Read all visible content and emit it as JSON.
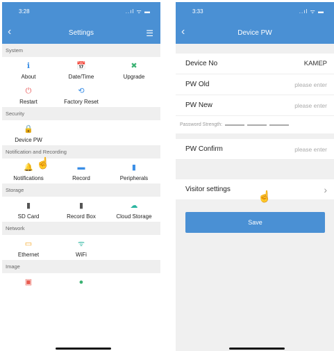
{
  "left": {
    "time": "3:28",
    "status_icons": "..ıl ᯤ ▬",
    "title": "Settings",
    "sections": [
      {
        "label": "System",
        "items": [
          {
            "label": "About",
            "icon": "info-icon",
            "glyph": "ℹ",
            "color": "#3a8ee6"
          },
          {
            "label": "Date/Time",
            "icon": "calendar-icon",
            "glyph": "📅",
            "color": "#e85a4f"
          },
          {
            "label": "Upgrade",
            "icon": "tools-icon",
            "glyph": "✖",
            "color": "#3bb273"
          },
          {
            "label": "Restart",
            "icon": "restart-icon",
            "glyph": "⏻",
            "color": "#e85a5a"
          },
          {
            "label": "Factory Reset",
            "icon": "reset-icon",
            "glyph": "⟲",
            "color": "#3a8ee6"
          }
        ]
      },
      {
        "label": "Security",
        "items": [
          {
            "label": "Device PW",
            "icon": "lock-icon",
            "glyph": "🔒",
            "color": "#3bb273"
          }
        ]
      },
      {
        "label": "Notification and Recording",
        "items": [
          {
            "label": "Notifications",
            "icon": "bell-icon",
            "glyph": "🔔",
            "color": "#f5a623"
          },
          {
            "label": "Record",
            "icon": "video-icon",
            "glyph": "▬",
            "color": "#3a8ee6"
          },
          {
            "label": "Peripherals",
            "icon": "peripheral-icon",
            "glyph": "▮",
            "color": "#3a8ee6"
          }
        ]
      },
      {
        "label": "Storage",
        "items": [
          {
            "label": "SD Card",
            "icon": "sdcard-icon",
            "glyph": "▮",
            "color": "#555"
          },
          {
            "label": "Record Box",
            "icon": "recordbox-icon",
            "glyph": "▮",
            "color": "#555"
          },
          {
            "label": "Cloud Storage",
            "icon": "cloud-icon",
            "glyph": "☁",
            "color": "#2bb5a0"
          }
        ]
      },
      {
        "label": "Network",
        "items": [
          {
            "label": "Ethernet",
            "icon": "ethernet-icon",
            "glyph": "▭",
            "color": "#f5a623"
          },
          {
            "label": "WiFi",
            "icon": "wifi-icon",
            "glyph": "ᯤ",
            "color": "#2bb5a0"
          }
        ]
      },
      {
        "label": "Image",
        "items": [
          {
            "label": "",
            "icon": "image-icon",
            "glyph": "▣",
            "color": "#e85a4f"
          },
          {
            "label": "",
            "icon": "osd-icon",
            "glyph": "●",
            "color": "#3bb273"
          }
        ]
      }
    ]
  },
  "right": {
    "time": "3:33",
    "status_icons": "..ıl ᯤ ▬",
    "title": "Device PW",
    "device_no_label": "Device No",
    "device_no_value": "KAMEP",
    "pw_old_label": "PW Old",
    "pw_old_placeholder": "please enter",
    "pw_new_label": "PW New",
    "pw_new_placeholder": "please enter",
    "strength_label": "Password Strength:",
    "pw_confirm_label": "PW Confirm",
    "pw_confirm_placeholder": "please enter",
    "visitor_label": "Visitor settings",
    "save_label": "Save"
  }
}
